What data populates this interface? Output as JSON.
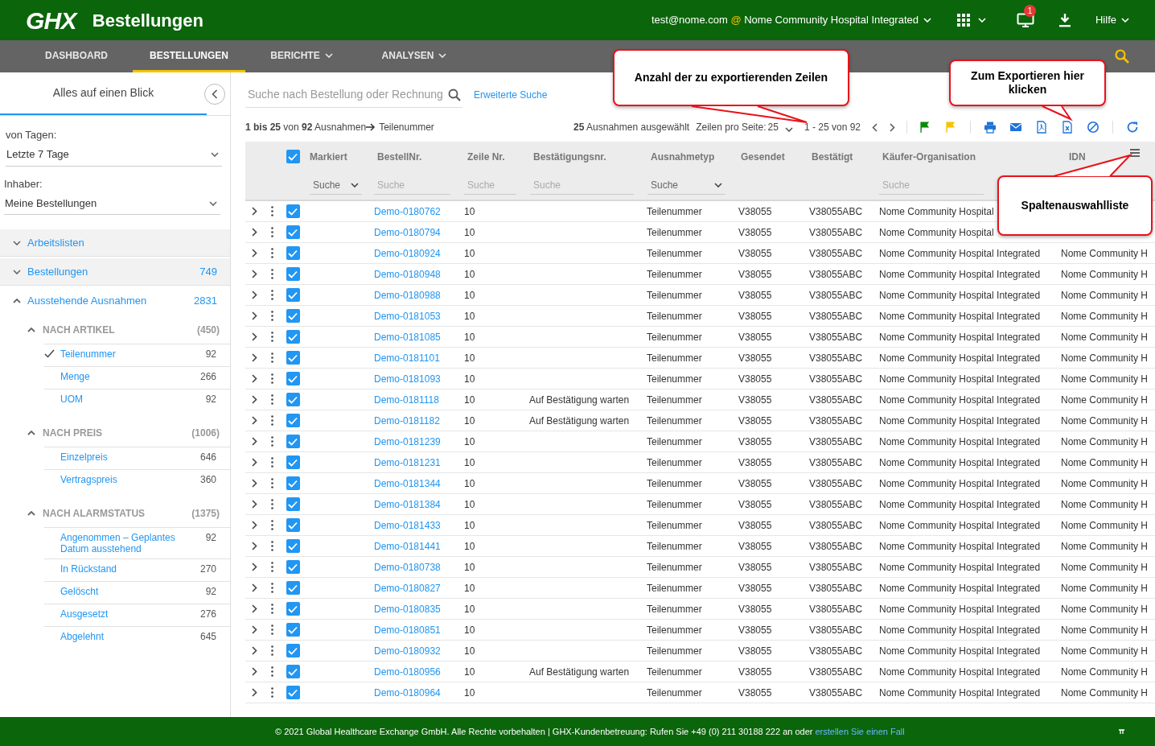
{
  "header": {
    "logo": "GHX",
    "title": "Bestellungen",
    "user": "test@nome.com",
    "at": "@",
    "organization": "Nome Community Hospital Integrated",
    "notification_count": "1",
    "help": "Hilfe"
  },
  "nav": {
    "tabs": [
      {
        "label": "DASHBOARD",
        "selected": false,
        "dropdown": false
      },
      {
        "label": "BESTELLUNGEN",
        "selected": true,
        "dropdown": false
      },
      {
        "label": "BERICHTE",
        "selected": false,
        "dropdown": true
      },
      {
        "label": "ANALYSEN",
        "selected": false,
        "dropdown": true
      }
    ]
  },
  "sidebar": {
    "title": "Alles auf einen Blick",
    "filters": [
      {
        "label": "von Tagen:",
        "value": "Letzte 7 Tage"
      },
      {
        "label": "Inhaber:",
        "value": "Meine Bestellungen"
      }
    ],
    "sections": [
      {
        "label": "Arbeitslisten",
        "expanded": false
      },
      {
        "label": "Bestellungen",
        "count": "749",
        "expanded": false
      },
      {
        "label": "Ausstehende Ausnahmen",
        "count": "2831",
        "expanded": true,
        "children": [
          {
            "label": "NACH ARTIKEL",
            "count": "(450)",
            "expanded": true,
            "children": [
              {
                "label": "Teilenummer",
                "count": "92",
                "selected": true
              },
              {
                "label": "Menge",
                "count": "266",
                "selected": false
              },
              {
                "label": "UOM",
                "count": "92",
                "selected": false
              }
            ]
          },
          {
            "label": "NACH PREIS",
            "count": "(1006)",
            "expanded": true,
            "children": [
              {
                "label": "Einzelpreis",
                "count": "646",
                "selected": false
              },
              {
                "label": "Vertragspreis",
                "count": "360",
                "selected": false
              }
            ]
          },
          {
            "label": "NACH ALARMSTATUS",
            "count": "(1375)",
            "expanded": true,
            "children": [
              {
                "label": "Angenommen – Geplantes Datum ausstehend",
                "count": "92",
                "selected": false
              },
              {
                "label": "In Rückstand",
                "count": "270",
                "selected": false
              },
              {
                "label": "Gelöscht",
                "count": "92",
                "selected": false
              },
              {
                "label": "Ausgesetzt",
                "count": "276",
                "selected": false
              },
              {
                "label": "Abgelehnt",
                "count": "645",
                "selected": false
              }
            ]
          }
        ]
      }
    ]
  },
  "toolbar": {
    "search_placeholder": "Suche nach Bestellung oder Rechnung",
    "advanced_search": "Erweiterte Suche",
    "summary": "**1 bis 25** von **92** Ausnahmen",
    "filter": "Teilenummer",
    "selected_info": "**25** Ausnahmen ausgewählt",
    "rows_per_page_label": "Zeilen pro Seite:",
    "rows_per_page": "25",
    "range": "1 - 25 von 92"
  },
  "table": {
    "select_all": true,
    "columns": [
      {
        "label": "Markiert",
        "filter": {
          "kind": "select",
          "placeholder": "Suche"
        }
      },
      {
        "label": "BestellNr.",
        "filter": {
          "kind": "text",
          "placeholder": "Suche"
        }
      },
      {
        "label": "Zeile Nr.",
        "filter": {
          "kind": "text",
          "placeholder": "Suche"
        }
      },
      {
        "label": "Bestätigungsnr.",
        "filter": {
          "kind": "text",
          "placeholder": "Suche"
        }
      },
      {
        "label": "Ausnahmetyp",
        "filter": {
          "kind": "select",
          "placeholder": "Suche"
        }
      },
      {
        "label": "Gesendet"
      },
      {
        "label": "Bestätigt"
      },
      {
        "label": "Käufer-Organisation",
        "filter": {
          "kind": "text",
          "placeholder": "Suche"
        }
      },
      {
        "label": "IDN"
      }
    ],
    "rows": [
      {
        "checked": true,
        "order": "Demo-0180762",
        "line": "10",
        "type": "Teilenummer",
        "sent": "V38055",
        "confirmed": "V38055ABC",
        "buyer": "Nome Community Hospital"
      },
      {
        "checked": true,
        "order": "Demo-0180794",
        "line": "10",
        "type": "Teilenummer",
        "sent": "V38055",
        "confirmed": "V38055ABC",
        "buyer": "Nome Community Hospital"
      },
      {
        "checked": true,
        "order": "Demo-0180924",
        "line": "10",
        "type": "Teilenummer",
        "sent": "V38055",
        "confirmed": "V38055ABC",
        "buyer": "Nome Community Hospital Integrated",
        "idn": "Nome Community H"
      },
      {
        "checked": true,
        "order": "Demo-0180948",
        "line": "10",
        "type": "Teilenummer",
        "sent": "V38055",
        "confirmed": "V38055ABC",
        "buyer": "Nome Community Hospital Integrated",
        "idn": "Nome Community H"
      },
      {
        "checked": true,
        "order": "Demo-0180988",
        "line": "10",
        "type": "Teilenummer",
        "sent": "V38055",
        "confirmed": "V38055ABC",
        "buyer": "Nome Community Hospital Integrated",
        "idn": "Nome Community H"
      },
      {
        "checked": true,
        "order": "Demo-0181053",
        "line": "10",
        "type": "Teilenummer",
        "sent": "V38055",
        "confirmed": "V38055ABC",
        "buyer": "Nome Community Hospital Integrated",
        "idn": "Nome Community H"
      },
      {
        "checked": true,
        "order": "Demo-0181085",
        "line": "10",
        "type": "Teilenummer",
        "sent": "V38055",
        "confirmed": "V38055ABC",
        "buyer": "Nome Community Hospital Integrated",
        "idn": "Nome Community H"
      },
      {
        "checked": true,
        "order": "Demo-0181101",
        "line": "10",
        "type": "Teilenummer",
        "sent": "V38055",
        "confirmed": "V38055ABC",
        "buyer": "Nome Community Hospital Integrated",
        "idn": "Nome Community H"
      },
      {
        "checked": true,
        "order": "Demo-0181093",
        "line": "10",
        "type": "Teilenummer",
        "sent": "V38055",
        "confirmed": "V38055ABC",
        "buyer": "Nome Community Hospital Integrated",
        "idn": "Nome Community H"
      },
      {
        "checked": true,
        "order": "Demo-0181118",
        "line": "10",
        "confirmation": "Auf Bestätigung warten",
        "type": "Teilenummer",
        "sent": "V38055",
        "confirmed": "V38055ABC",
        "buyer": "Nome Community Hospital Integrated",
        "idn": "Nome Community H"
      },
      {
        "checked": true,
        "order": "Demo-0181182",
        "line": "10",
        "confirmation": "Auf Bestätigung warten",
        "type": "Teilenummer",
        "sent": "V38055",
        "confirmed": "V38055ABC",
        "buyer": "Nome Community Hospital Integrated",
        "idn": "Nome Community H"
      },
      {
        "checked": true,
        "order": "Demo-0181239",
        "line": "10",
        "type": "Teilenummer",
        "sent": "V38055",
        "confirmed": "V38055ABC",
        "buyer": "Nome Community Hospital Integrated",
        "idn": "Nome Community H"
      },
      {
        "checked": true,
        "order": "Demo-0181231",
        "line": "10",
        "type": "Teilenummer",
        "sent": "V38055",
        "confirmed": "V38055ABC",
        "buyer": "Nome Community Hospital Integrated",
        "idn": "Nome Community H"
      },
      {
        "checked": true,
        "order": "Demo-0181344",
        "line": "10",
        "type": "Teilenummer",
        "sent": "V38055",
        "confirmed": "V38055ABC",
        "buyer": "Nome Community Hospital Integrated",
        "idn": "Nome Community H"
      },
      {
        "checked": true,
        "order": "Demo-0181384",
        "line": "10",
        "type": "Teilenummer",
        "sent": "V38055",
        "confirmed": "V38055ABC",
        "buyer": "Nome Community Hospital Integrated",
        "idn": "Nome Community H"
      },
      {
        "checked": true,
        "order": "Demo-0181433",
        "line": "10",
        "type": "Teilenummer",
        "sent": "V38055",
        "confirmed": "V38055ABC",
        "buyer": "Nome Community Hospital Integrated",
        "idn": "Nome Community H"
      },
      {
        "checked": true,
        "order": "Demo-0181441",
        "line": "10",
        "type": "Teilenummer",
        "sent": "V38055",
        "confirmed": "V38055ABC",
        "buyer": "Nome Community Hospital Integrated",
        "idn": "Nome Community H"
      },
      {
        "checked": true,
        "order": "Demo-0180738",
        "line": "10",
        "type": "Teilenummer",
        "sent": "V38055",
        "confirmed": "V38055ABC",
        "buyer": "Nome Community Hospital Integrated",
        "idn": "Nome Community H"
      },
      {
        "checked": true,
        "order": "Demo-0180827",
        "line": "10",
        "type": "Teilenummer",
        "sent": "V38055",
        "confirmed": "V38055ABC",
        "buyer": "Nome Community Hospital Integrated",
        "idn": "Nome Community H"
      },
      {
        "checked": true,
        "order": "Demo-0180835",
        "line": "10",
        "type": "Teilenummer",
        "sent": "V38055",
        "confirmed": "V38055ABC",
        "buyer": "Nome Community Hospital Integrated",
        "idn": "Nome Community H"
      },
      {
        "checked": true,
        "order": "Demo-0180851",
        "line": "10",
        "type": "Teilenummer",
        "sent": "V38055",
        "confirmed": "V38055ABC",
        "buyer": "Nome Community Hospital Integrated",
        "idn": "Nome Community H"
      },
      {
        "checked": true,
        "order": "Demo-0180932",
        "line": "10",
        "type": "Teilenummer",
        "sent": "V38055",
        "confirmed": "V38055ABC",
        "buyer": "Nome Community Hospital Integrated",
        "idn": "Nome Community H"
      },
      {
        "checked": true,
        "order": "Demo-0180956",
        "line": "10",
        "confirmation": "Auf Bestätigung warten",
        "type": "Teilenummer",
        "sent": "V38055",
        "confirmed": "V38055ABC",
        "buyer": "Nome Community Hospital Integrated",
        "idn": "Nome Community H"
      },
      {
        "checked": true,
        "order": "Demo-0180964",
        "line": "10",
        "type": "Teilenummer",
        "sent": "V38055",
        "confirmed": "V38055ABC",
        "buyer": "Nome Community Hospital Integrated",
        "idn": "Nome Community H"
      }
    ]
  },
  "callouts": [
    {
      "text": "Anzahl der zu exportierenden Zeilen"
    },
    {
      "text": "Zum Exportieren hier klicken"
    },
    {
      "text": "Spaltenauswahlliste"
    }
  ],
  "footer": {
    "text": "© 2021 Global Healthcare Exchange GmbH. Alle Rechte vorbehalten | GHX-Kundenbetreuung: Rufen Sie +49 (0) 211 30188 222 an oder",
    "link": "erstellen Sie einen Fall"
  }
}
